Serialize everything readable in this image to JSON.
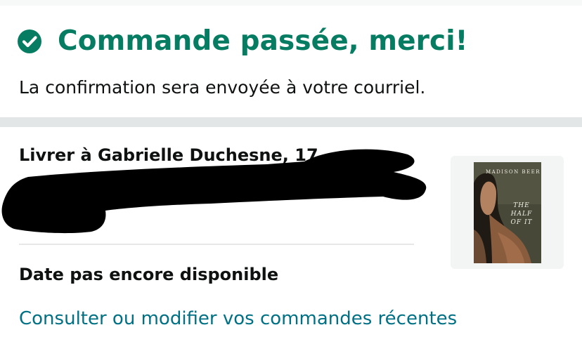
{
  "confirmation": {
    "title": "Commande passée, merci!",
    "subtitle": "La confirmation sera envoyée à votre courriel."
  },
  "shipping": {
    "ship_to": "Livrer à Gabrielle Duchesne, 17"
  },
  "delivery": {
    "date_text": "Date pas encore disponible"
  },
  "links": {
    "orders": "Consulter ou modifier vos commandes récentes"
  },
  "product": {
    "cover_author": "MADISON BEER",
    "cover_title": "THE HALF OF IT"
  },
  "colors": {
    "accent_green": "#067d62",
    "link_teal": "#007185",
    "text": "#0f1111",
    "divider_band": "#e3e6e6"
  },
  "icons": {
    "confirm": "check-circle-icon"
  }
}
